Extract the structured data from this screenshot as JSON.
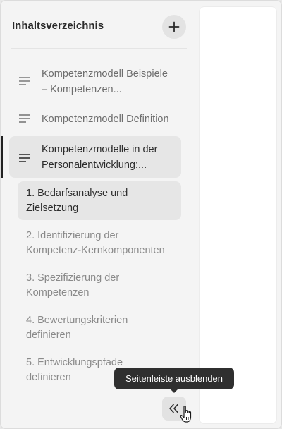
{
  "header": {
    "title": "Inhaltsverzeichnis"
  },
  "toc": {
    "items": [
      {
        "label_line1": "Kompetenzmodell Beispiele",
        "label_line2": "– Kompetenzen..."
      },
      {
        "label_line1": "Kompetenzmodell Definition"
      },
      {
        "label_line1": "Kompetenzmodelle in der",
        "label_line2": "Personalentwicklung:...",
        "active": true
      }
    ],
    "sub_items": [
      {
        "line1": "1. Bedarfsanalyse und",
        "line2": "Zielsetzung",
        "active": true
      },
      {
        "line1": "2. Identifizierung der",
        "line2": "Kompetenz-Kernkomponenten"
      },
      {
        "line1": "3. Spezifizierung der",
        "line2": "Kompetenzen"
      },
      {
        "line1": "4. Bewertungskriterien",
        "line2": "definieren"
      },
      {
        "line1": "5. Entwicklungspfade",
        "line2": "definieren"
      }
    ]
  },
  "tooltip": {
    "text": "Seitenleiste ausblenden"
  },
  "icons": {
    "add": "plus-icon",
    "toc_item": "list-lines-icon",
    "collapse": "double-chevron-left-icon",
    "cursor": "hand-pointer-icon"
  },
  "colors": {
    "sidebar_bg": "#f4f4f4",
    "active_bg": "#e6e6e6",
    "active_bar": "#222222",
    "tooltip_bg": "#2f2f2f"
  }
}
